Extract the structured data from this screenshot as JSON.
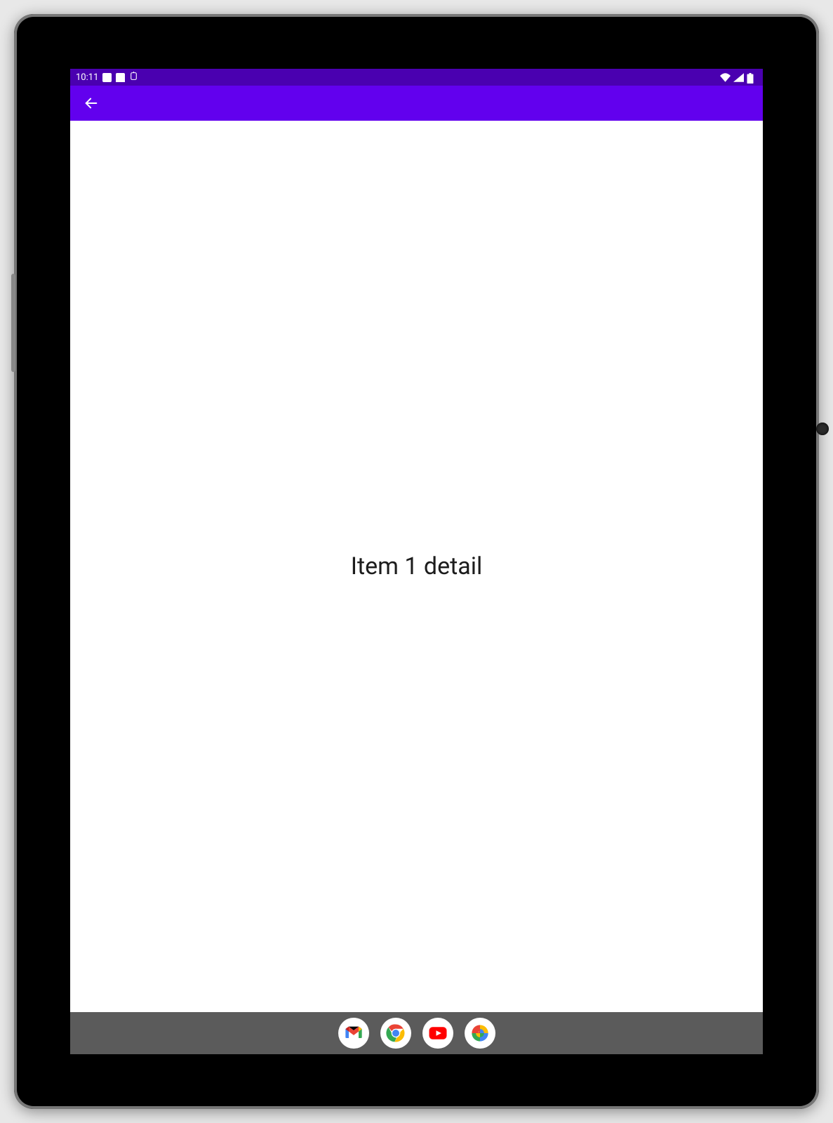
{
  "status_bar": {
    "time": "10:11",
    "status_bar_color": "#4a00b0"
  },
  "app_bar": {
    "color": "#6200ee"
  },
  "content": {
    "detail_text": "Item 1 detail"
  },
  "nav_bar": {
    "apps": [
      {
        "name": "gmail"
      },
      {
        "name": "chrome"
      },
      {
        "name": "youtube"
      },
      {
        "name": "photos"
      }
    ]
  }
}
